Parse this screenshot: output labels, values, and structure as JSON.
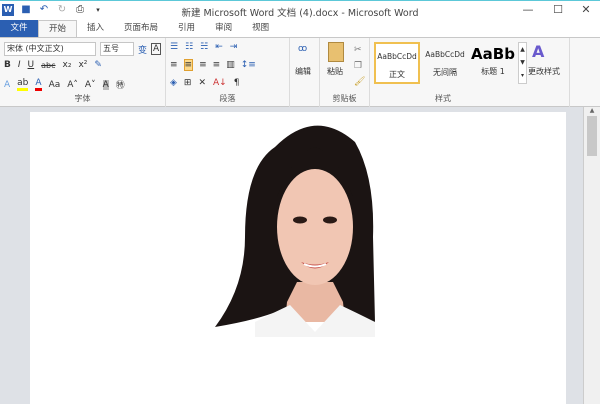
{
  "window": {
    "title": "新建 Microsoft Word 文档 (4).docx - Microsoft Word"
  },
  "qat": {
    "icons": [
      "word-logo-icon",
      "save-icon",
      "undo-icon",
      "redo-icon",
      "print-preview-icon",
      "customize-icon"
    ]
  },
  "tabs": [
    {
      "label": "文件"
    },
    {
      "label": "开始"
    },
    {
      "label": "插入"
    },
    {
      "label": "页面布局"
    },
    {
      "label": "引用"
    },
    {
      "label": "审阅"
    },
    {
      "label": "视图"
    }
  ],
  "font": {
    "name": "宋体 (中文正文)",
    "size": "五号",
    "label": "字体"
  },
  "paragraph": {
    "label": "段落"
  },
  "edit": {
    "label": "编辑"
  },
  "clipboard": {
    "paste": "粘贴",
    "label": "剪贴板"
  },
  "styles": {
    "label": "样式",
    "items": [
      {
        "preview": "AaBbCcDd",
        "name": "正文"
      },
      {
        "preview": "AaBbCcDd",
        "name": "无间隔"
      },
      {
        "preview": "AaBb",
        "name": "标题 1"
      }
    ],
    "change": "更改样式"
  },
  "colors": {
    "file_tab": "#2b5fb2",
    "selected": "#fcd98a",
    "doc_bg": "#dee1e6"
  }
}
